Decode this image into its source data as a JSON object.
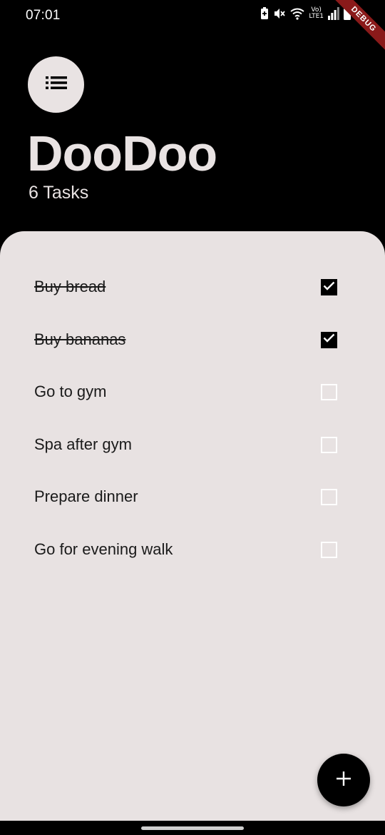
{
  "status_bar": {
    "time": "07:01",
    "icons": [
      "battery-saver-icon",
      "mute-icon",
      "wifi-icon",
      "volte-lte-icon",
      "signal-icon",
      "battery-icon"
    ],
    "volte_label": "Vo)",
    "lte_label": "LTE1",
    "debug_label": "DEBUG"
  },
  "header": {
    "menu_icon": "list-icon",
    "title": "DooDoo",
    "subtitle": "6 Tasks"
  },
  "tasks": [
    {
      "label": "Buy bread",
      "done": true
    },
    {
      "label": "Buy bananas",
      "done": true
    },
    {
      "label": "Go to gym",
      "done": false
    },
    {
      "label": "Spa after gym",
      "done": false
    },
    {
      "label": "Prepare dinner",
      "done": false
    },
    {
      "label": "Go for evening walk",
      "done": false
    }
  ],
  "fab": {
    "icon": "plus-icon"
  },
  "colors": {
    "background": "#000000",
    "panel": "#e8e2e2",
    "header_text": "#e9e3e3",
    "checkbox_checked": "#000000",
    "checkbox_unchecked_border": "#ffffff"
  }
}
